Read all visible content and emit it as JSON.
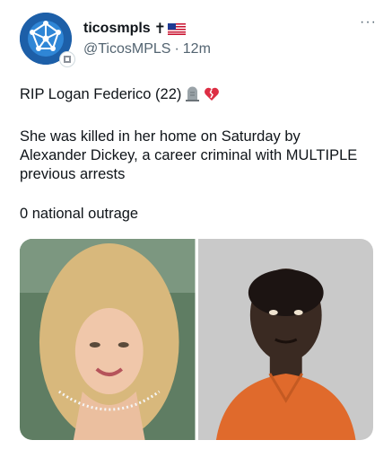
{
  "author": {
    "display_name": "ticosmpls",
    "cross": "✝",
    "flag_icon": "us-flag-icon",
    "handle": "@TicosMPLS",
    "separator": "·",
    "time": "12m"
  },
  "more_label": "···",
  "tweet": {
    "line1": "RIP Logan Federico (22)",
    "line1_emojis": [
      "headstone-icon",
      "broken-heart-icon"
    ],
    "line2": "She was killed in her home on Saturday by\nAlexander Dickey, a career criminal with MULTIPLE\nprevious arrests",
    "line3": "0 national outrage"
  },
  "media": [
    "photo-left",
    "photo-right"
  ],
  "colors": {
    "text": "#0f1419",
    "secondary": "#536471",
    "avatar": "#1d5fa8",
    "orange_shirt": "#e06a2c"
  }
}
